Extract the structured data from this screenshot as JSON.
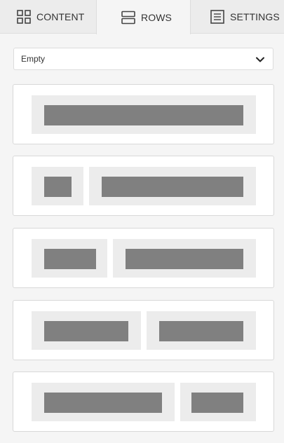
{
  "tabs": [
    {
      "label": "CONTENT",
      "icon": "grid-icon"
    },
    {
      "label": "ROWS",
      "icon": "rows-icon",
      "active": true
    },
    {
      "label": "SETTINGS",
      "icon": "settings-list-icon"
    }
  ],
  "filter": {
    "selected": "Empty",
    "icon": "chevron-down-icon"
  },
  "row_layouts": [
    {
      "name": "one-column",
      "columns": [
        1
      ]
    },
    {
      "name": "two-column-small-left",
      "columns": [
        1,
        3
      ]
    },
    {
      "name": "two-column-third-left",
      "columns": [
        1,
        2
      ]
    },
    {
      "name": "two-column-equal",
      "columns": [
        1,
        1
      ]
    },
    {
      "name": "two-column-small-right",
      "columns": [
        2,
        1
      ]
    }
  ],
  "colors": {
    "tab_bar": "#ececec",
    "active_tab": "#f5f5f5",
    "card_border": "#d8d8d8",
    "cell_background": "#ececec",
    "bar_fill": "#808080"
  }
}
